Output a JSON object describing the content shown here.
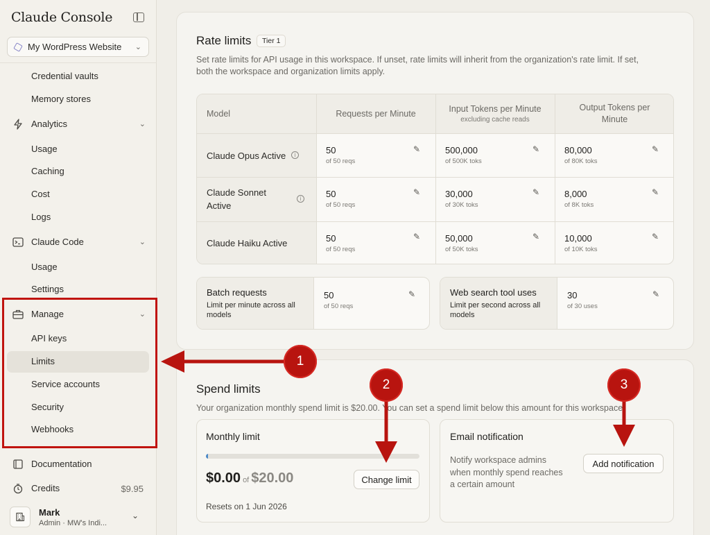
{
  "sidebar": {
    "brand": "Claude Console",
    "workspace": "My WordPress Website",
    "items": {
      "credential_vaults": "Credential vaults",
      "memory_stores": "Memory stores",
      "analytics": "Analytics",
      "analytics_usage": "Usage",
      "caching": "Caching",
      "cost": "Cost",
      "logs": "Logs",
      "claude_code": "Claude Code",
      "cc_usage": "Usage",
      "cc_settings": "Settings",
      "manage": "Manage",
      "api_keys": "API keys",
      "limits": "Limits",
      "service_accounts": "Service accounts",
      "security": "Security",
      "webhooks": "Webhooks",
      "documentation": "Documentation",
      "credits": "Credits",
      "credits_value": "$9.95"
    },
    "user": {
      "name": "Mark",
      "role": "Admin",
      "org": "MW's Indi..."
    }
  },
  "rate_limits": {
    "title": "Rate limits",
    "tier": "Tier 1",
    "description_1": "Set rate limits for API usage in this workspace. If unset, rate limits will inherit from the organization's rate limit. If set,",
    "description_2": "both the workspace and organization limits apply.",
    "headers": {
      "model": "Model",
      "rpm": "Requests per Minute",
      "itpm": "Input Tokens per Minute",
      "itpm_sub": "excluding cache reads",
      "otpm_1": "Output Tokens per",
      "otpm_2": "Minute"
    },
    "rows": [
      {
        "model": "Claude Opus Active",
        "rpm": "50",
        "rpm_sub": "of 50 reqs",
        "itpm": "500,000",
        "itpm_sub": "of 500K toks",
        "otpm": "80,000",
        "otpm_sub": "of 80K toks"
      },
      {
        "model_1": "Claude Sonnet",
        "model_2": "Active",
        "rpm": "50",
        "rpm_sub": "of 50 reqs",
        "itpm": "30,000",
        "itpm_sub": "of 30K toks",
        "otpm": "8,000",
        "otpm_sub": "of 8K toks"
      },
      {
        "model": "Claude Haiku Active",
        "rpm": "50",
        "rpm_sub": "of 50 reqs",
        "itpm": "50,000",
        "itpm_sub": "of 50K toks",
        "otpm": "10,000",
        "otpm_sub": "of 10K toks"
      }
    ],
    "batch": {
      "title": "Batch requests",
      "desc_1": "Limit per minute across all",
      "desc_2": "models",
      "value": "50",
      "sub": "of 50 reqs"
    },
    "web_search": {
      "title": "Web search tool uses",
      "desc_1": "Limit per second across all",
      "desc_2": "models",
      "value": "30",
      "sub": "of 30 uses"
    }
  },
  "spend_limits": {
    "title": "Spend limits",
    "description": "Your organization monthly spend limit is $20.00. You can set a spend limit below this amount for this workspace.",
    "monthly": {
      "title": "Monthly limit",
      "spent": "$0.00",
      "of": "of",
      "limit": "$20.00",
      "progress_fraction": 0.01,
      "change_button": "Change limit",
      "resets": "Resets on 1 Jun 2026"
    },
    "email": {
      "title": "Email notification",
      "desc_1": "Notify workspace admins",
      "desc_2": "when monthly spend reaches",
      "desc_3": "a certain amount",
      "add_button": "Add notification"
    }
  },
  "callouts": [
    "1",
    "2",
    "3"
  ],
  "colors": {
    "annotation_red": "#b8140f",
    "progress_blue": "#4a88c7"
  }
}
